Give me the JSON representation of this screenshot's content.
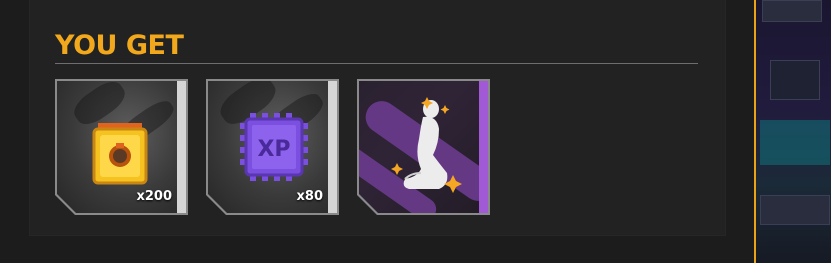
{
  "header": {
    "title": "YOU GET"
  },
  "rewards": [
    {
      "name": "gold-token",
      "quantity": "x200",
      "accent": "#d6d6d6"
    },
    {
      "name": "xp-chip",
      "quantity": "x80",
      "accent": "#d6d6d6"
    },
    {
      "name": "kneeling-pose-emote",
      "quantity": "",
      "accent": "#a259d6"
    }
  ],
  "colors": {
    "title": "#f2a81d",
    "border_right": "#e8a317"
  }
}
